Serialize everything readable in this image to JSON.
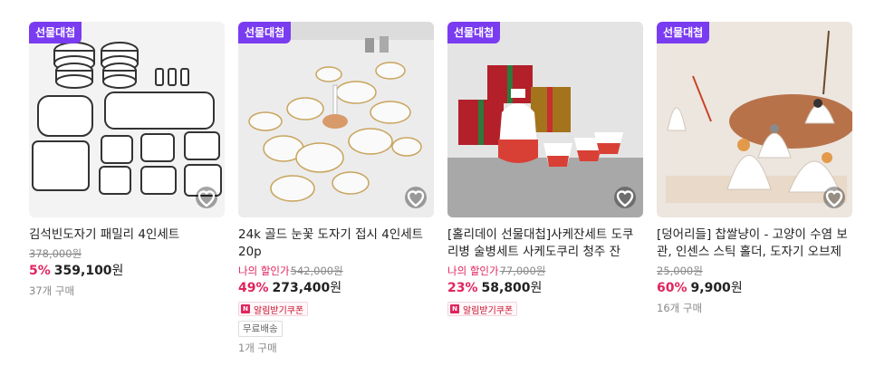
{
  "products": [
    {
      "badge": "선물대첩",
      "title": "김석빈도자기 패밀리 4인세트",
      "original_price": "378,000원",
      "discount_rate": "5%",
      "price": "359,100",
      "won": "원",
      "sold": "37개 구매"
    },
    {
      "badge": "선물대첩",
      "title": "24k 골드 눈꽃 도자기 접시 4인세트 20p",
      "my_price_label": "나의 할인가",
      "original_price": "542,000원",
      "discount_rate": "49%",
      "price": "273,400",
      "won": "원",
      "coupon": "알림받기쿠폰",
      "tag": "무료배송",
      "sold": "1개 구매"
    },
    {
      "badge": "선물대첩",
      "title": "[홀리데이 선물대첩]사케잔세트 도쿠리병 술병세트 사케도쿠리 청주 잔",
      "my_price_label": "나의 할인가",
      "original_price": "77,000원",
      "discount_rate": "23%",
      "price": "58,800",
      "won": "원",
      "coupon": "알림받기쿠폰"
    },
    {
      "badge": "선물대첩",
      "title": "[덩어리들] 찹쌀냥이 - 고양이 수염 보관, 인센스 스틱 홀더, 도자기 오브제",
      "original_price": "25,000원",
      "discount_rate": "60%",
      "price": "9,900",
      "won": "원",
      "sold": "16개 구매"
    }
  ],
  "colors": {
    "badge": "#7a3cf0",
    "discount": "#e0245e"
  }
}
